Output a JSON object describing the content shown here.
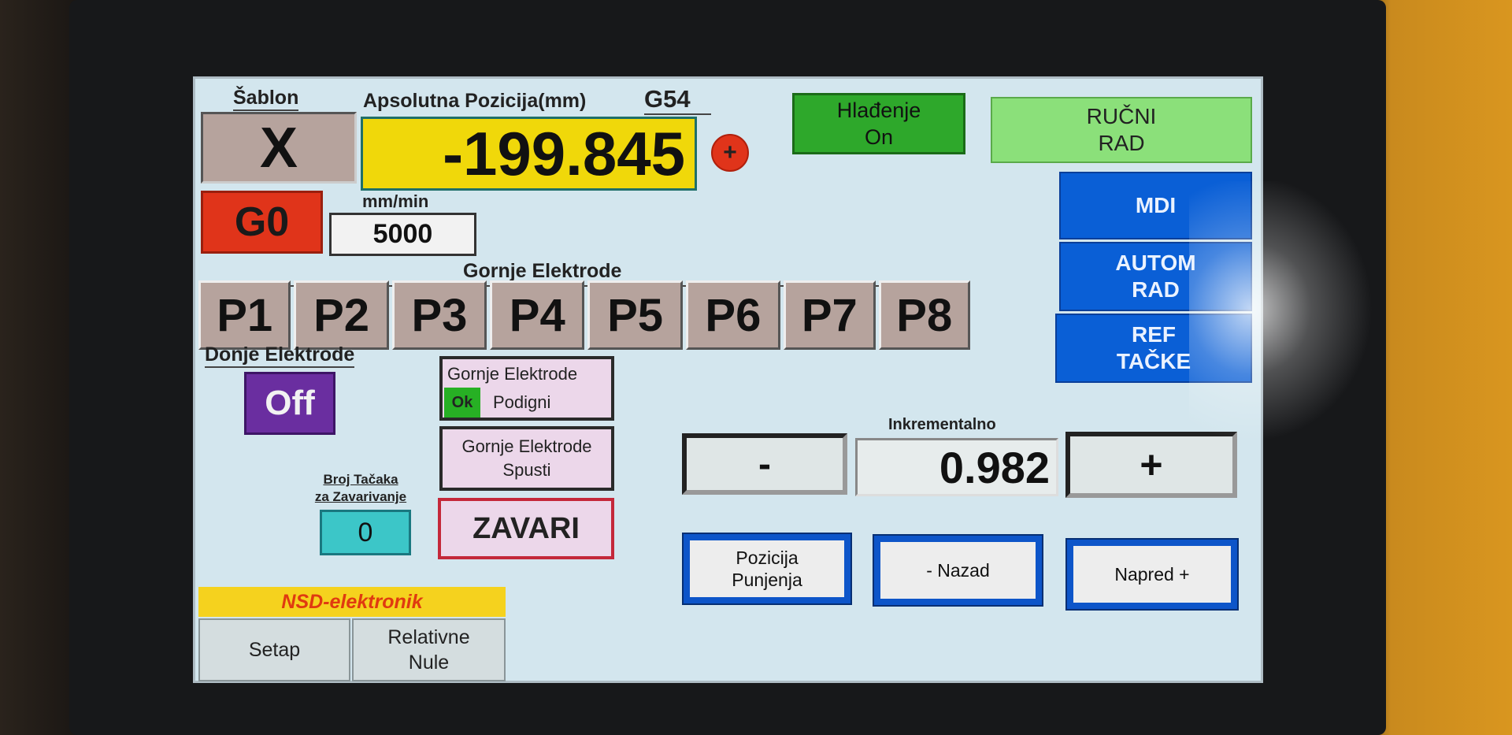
{
  "header": {
    "sablon_label": "Šablon",
    "axis": "X",
    "position_label": "Apsolutna Pozicija(mm)",
    "coord_system": "G54",
    "position_value": "-199.845",
    "sign_button": "+"
  },
  "motion": {
    "mode": "G0",
    "feed_unit": "mm/min",
    "feed_value": "5000"
  },
  "status": {
    "cooling_line1": "Hlađenje",
    "cooling_line2": "On",
    "manual_line1": "RUČNI",
    "manual_line2": "RAD"
  },
  "side_menu": [
    {
      "line1": "MDI",
      "line2": ""
    },
    {
      "line1": "AUTOM",
      "line2": "RAD"
    },
    {
      "line1": "REF",
      "line2": "TAČKE"
    }
  ],
  "upper_electrodes": {
    "title": "Gornje Elektrode",
    "items": [
      "P1",
      "P2",
      "P3",
      "P4",
      "P5",
      "P6",
      "P7",
      "P8"
    ]
  },
  "lower_electrodes": {
    "title": "Donje Elektrode",
    "state": "Off"
  },
  "controls": {
    "raise_line1": "Gornje Elektrode",
    "raise_status": "Ok",
    "raise_line2": "Podigni",
    "lower_line1": "Gornje Elektrode",
    "lower_line2": "Spusti",
    "weld_button": "ZAVARI",
    "points_label_line1": "Broj Tačaka",
    "points_label_line2": "za Zavarivanje",
    "points_value": "0"
  },
  "increment": {
    "label": "Inkrementalno",
    "minus": "-",
    "value": "0.982",
    "plus": "+"
  },
  "nav": {
    "load_line1": "Pozicija",
    "load_line2": "Punjenja",
    "back": "- Nazad",
    "forward": "Napred +"
  },
  "footer": {
    "brand": "NSD-elektronik",
    "setup": "Setap",
    "relative_line1": "Relativne",
    "relative_line2": "Nule"
  },
  "colors": {
    "screen_bg": "#d3e6ee",
    "position_yellow": "#f0d80a",
    "mode_red": "#e0341a",
    "cooling_green": "#2ea82b",
    "manual_green": "#8be07a",
    "menu_blue": "#0a5fd6",
    "off_purple": "#6a2ea0",
    "points_cyan": "#3cc6c8",
    "tile_taupe": "#b6a39d",
    "brand_yellow": "#f5d21e",
    "brand_text": "#e03a10"
  }
}
